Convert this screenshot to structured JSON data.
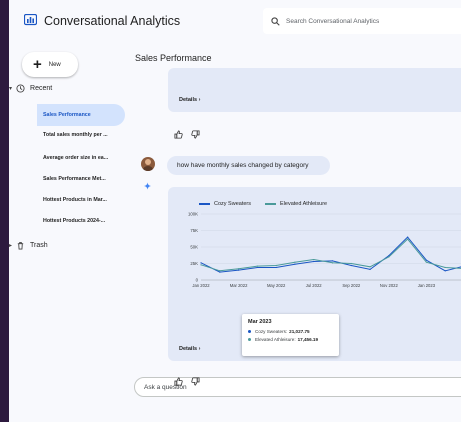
{
  "app": {
    "title": "Conversational Analytics"
  },
  "search": {
    "placeholder": "Search Conversational Analytics"
  },
  "sidebar": {
    "new_label": "New",
    "recent_label": "Recent",
    "trash_label": "Trash",
    "items": [
      {
        "label": "Sales Performance",
        "active": true
      },
      {
        "label": "Total sales monthly per ...",
        "active": false
      },
      {
        "label": "Average order size in ea...",
        "active": false
      },
      {
        "label": "Sales Performance Met...",
        "active": false
      },
      {
        "label": "Hottest Products in Mar...",
        "active": false
      },
      {
        "label": "Hottest Products 2024-...",
        "active": false
      }
    ]
  },
  "main": {
    "title": "Sales Performance",
    "top_card_text": "Details",
    "question": "how have monthly sales changed by category",
    "details_label": "Details",
    "ask_placeholder": "Ask a question"
  },
  "chart_data": {
    "type": "line",
    "x": [
      "Jan 2022",
      "Feb 2022",
      "Mar 2022",
      "Apr 2022",
      "May 2022",
      "Jun 2022",
      "Jul 2022",
      "Aug 2022",
      "Sep 2022",
      "Oct 2022",
      "Nov 2022",
      "Dec 2022",
      "Jan 2023",
      "Feb 2023",
      "Mar 2023"
    ],
    "xticks": [
      "Jan 2022",
      "Mar 2022",
      "May 2022",
      "Jul 2022",
      "Sep 2022",
      "Nov 2022",
      "Jan 2023"
    ],
    "yticks": [
      "0",
      "25K",
      "50K",
      "75K",
      "100K"
    ],
    "ylim": [
      0,
      100000
    ],
    "series": [
      {
        "name": "Cozy Sweaters",
        "color": "#1a56c4",
        "values": [
          26000,
          12000,
          15000,
          19000,
          19000,
          24000,
          28000,
          29000,
          22000,
          16000,
          37000,
          65000,
          30000,
          14000,
          21028
        ]
      },
      {
        "name": "Elevated Athleisure",
        "color": "#4a9a9a",
        "values": [
          23000,
          14000,
          17000,
          21000,
          22000,
          27000,
          31000,
          26000,
          25000,
          20000,
          35000,
          62000,
          27000,
          19000,
          17456
        ]
      }
    ]
  },
  "tooltip": {
    "title": "Mar 2023",
    "rows": [
      {
        "label": "Cozy Sweaters:",
        "value": "21,027.75",
        "color": "#1a56c4"
      },
      {
        "label": "Elevated Athleisure:",
        "value": "17,456.19",
        "color": "#4a9a9a"
      }
    ]
  }
}
